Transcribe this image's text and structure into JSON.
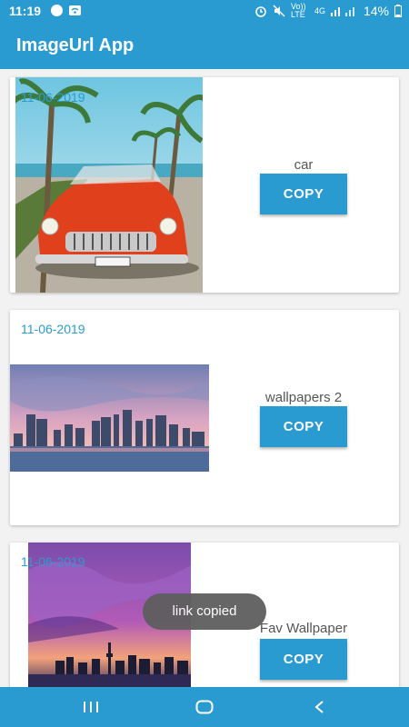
{
  "status_bar": {
    "time": "11:19",
    "battery": "14%",
    "icons": [
      "whatsapp-icon",
      "wifi-icon",
      "alarm-icon",
      "mute-icon",
      "volte-icon",
      "signal-4g-icon",
      "signal-icon",
      "battery-icon"
    ],
    "volte_label": "Vo)) LTE",
    "network_label": "4G"
  },
  "app_bar": {
    "title": "ImageUrl App"
  },
  "cards": [
    {
      "date": "11-06-2019",
      "name": "car",
      "copy_label": "COPY"
    },
    {
      "date": "11-06-2019",
      "name": "wallpapers 2",
      "copy_label": "COPY"
    },
    {
      "date": "11-06-2019",
      "name": "Fav Wallpaper",
      "copy_label": "COPY"
    }
  ],
  "toast": {
    "message": "link copied"
  },
  "nav_bar": {
    "buttons": [
      "recents-icon",
      "home-icon",
      "back-icon"
    ]
  },
  "colors": {
    "primary": "#2a9bd1",
    "toast_bg": "#5e5e5e"
  }
}
